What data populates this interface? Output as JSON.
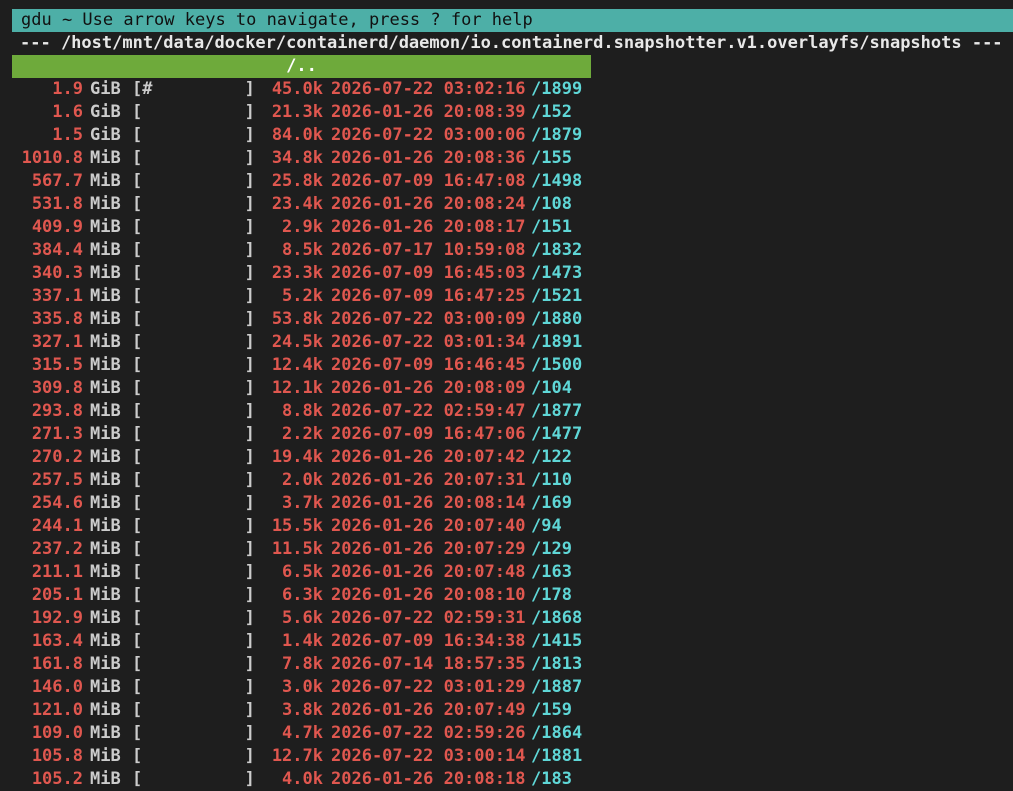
{
  "header": {
    "title": "gdu ~ Use arrow keys to navigate, press ? for help",
    "path": "--- /host/mnt/data/docker/containerd/daemon/io.containerd.snapshotter.v1.overlayfs/snapshots ---",
    "parent": "/.."
  },
  "rows": [
    {
      "size": "1.9",
      "unit": "GiB",
      "bar": "[#         ]",
      "count": "45.0k",
      "date": "2026-07-22 03:02:16",
      "name": "/1899"
    },
    {
      "size": "1.6",
      "unit": "GiB",
      "bar": "[          ]",
      "count": "21.3k",
      "date": "2026-01-26 20:08:39",
      "name": "/152"
    },
    {
      "size": "1.5",
      "unit": "GiB",
      "bar": "[          ]",
      "count": "84.0k",
      "date": "2026-07-22 03:00:06",
      "name": "/1879"
    },
    {
      "size": "1010.8",
      "unit": "MiB",
      "bar": "[          ]",
      "count": "34.8k",
      "date": "2026-01-26 20:08:36",
      "name": "/155"
    },
    {
      "size": "567.7",
      "unit": "MiB",
      "bar": "[          ]",
      "count": "25.8k",
      "date": "2026-07-09 16:47:08",
      "name": "/1498"
    },
    {
      "size": "531.8",
      "unit": "MiB",
      "bar": "[          ]",
      "count": "23.4k",
      "date": "2026-01-26 20:08:24",
      "name": "/108"
    },
    {
      "size": "409.9",
      "unit": "MiB",
      "bar": "[          ]",
      "count": "2.9k",
      "date": "2026-01-26 20:08:17",
      "name": "/151"
    },
    {
      "size": "384.4",
      "unit": "MiB",
      "bar": "[          ]",
      "count": "8.5k",
      "date": "2026-07-17 10:59:08",
      "name": "/1832"
    },
    {
      "size": "340.3",
      "unit": "MiB",
      "bar": "[          ]",
      "count": "23.3k",
      "date": "2026-07-09 16:45:03",
      "name": "/1473"
    },
    {
      "size": "337.1",
      "unit": "MiB",
      "bar": "[          ]",
      "count": "5.2k",
      "date": "2026-07-09 16:47:25",
      "name": "/1521"
    },
    {
      "size": "335.8",
      "unit": "MiB",
      "bar": "[          ]",
      "count": "53.8k",
      "date": "2026-07-22 03:00:09",
      "name": "/1880"
    },
    {
      "size": "327.1",
      "unit": "MiB",
      "bar": "[          ]",
      "count": "24.5k",
      "date": "2026-07-22 03:01:34",
      "name": "/1891"
    },
    {
      "size": "315.5",
      "unit": "MiB",
      "bar": "[          ]",
      "count": "12.4k",
      "date": "2026-07-09 16:46:45",
      "name": "/1500"
    },
    {
      "size": "309.8",
      "unit": "MiB",
      "bar": "[          ]",
      "count": "12.1k",
      "date": "2026-01-26 20:08:09",
      "name": "/104"
    },
    {
      "size": "293.8",
      "unit": "MiB",
      "bar": "[          ]",
      "count": "8.8k",
      "date": "2026-07-22 02:59:47",
      "name": "/1877"
    },
    {
      "size": "271.3",
      "unit": "MiB",
      "bar": "[          ]",
      "count": "2.2k",
      "date": "2026-07-09 16:47:06",
      "name": "/1477"
    },
    {
      "size": "270.2",
      "unit": "MiB",
      "bar": "[          ]",
      "count": "19.4k",
      "date": "2026-01-26 20:07:42",
      "name": "/122"
    },
    {
      "size": "257.5",
      "unit": "MiB",
      "bar": "[          ]",
      "count": "2.0k",
      "date": "2026-01-26 20:07:31",
      "name": "/110"
    },
    {
      "size": "254.6",
      "unit": "MiB",
      "bar": "[          ]",
      "count": "3.7k",
      "date": "2026-01-26 20:08:14",
      "name": "/169"
    },
    {
      "size": "244.1",
      "unit": "MiB",
      "bar": "[          ]",
      "count": "15.5k",
      "date": "2026-01-26 20:07:40",
      "name": "/94"
    },
    {
      "size": "237.2",
      "unit": "MiB",
      "bar": "[          ]",
      "count": "11.5k",
      "date": "2026-01-26 20:07:29",
      "name": "/129"
    },
    {
      "size": "211.1",
      "unit": "MiB",
      "bar": "[          ]",
      "count": "6.5k",
      "date": "2026-01-26 20:07:48",
      "name": "/163"
    },
    {
      "size": "205.1",
      "unit": "MiB",
      "bar": "[          ]",
      "count": "6.3k",
      "date": "2026-01-26 20:08:10",
      "name": "/178"
    },
    {
      "size": "192.9",
      "unit": "MiB",
      "bar": "[          ]",
      "count": "5.6k",
      "date": "2026-07-22 02:59:31",
      "name": "/1868"
    },
    {
      "size": "163.4",
      "unit": "MiB",
      "bar": "[          ]",
      "count": "1.4k",
      "date": "2026-07-09 16:34:38",
      "name": "/1415"
    },
    {
      "size": "161.8",
      "unit": "MiB",
      "bar": "[          ]",
      "count": "7.8k",
      "date": "2026-07-14 18:57:35",
      "name": "/1813"
    },
    {
      "size": "146.0",
      "unit": "MiB",
      "bar": "[          ]",
      "count": "3.0k",
      "date": "2026-07-22 03:01:29",
      "name": "/1887"
    },
    {
      "size": "121.0",
      "unit": "MiB",
      "bar": "[          ]",
      "count": "3.8k",
      "date": "2026-01-26 20:07:49",
      "name": "/159"
    },
    {
      "size": "109.0",
      "unit": "MiB",
      "bar": "[          ]",
      "count": "4.7k",
      "date": "2026-07-22 02:59:26",
      "name": "/1864"
    },
    {
      "size": "105.8",
      "unit": "MiB",
      "bar": "[          ]",
      "count": "12.7k",
      "date": "2026-07-22 03:00:14",
      "name": "/1881"
    },
    {
      "size": "105.2",
      "unit": "MiB",
      "bar": "[          ]",
      "count": "4.0k",
      "date": "2026-01-26 20:08:18",
      "name": "/183"
    }
  ]
}
